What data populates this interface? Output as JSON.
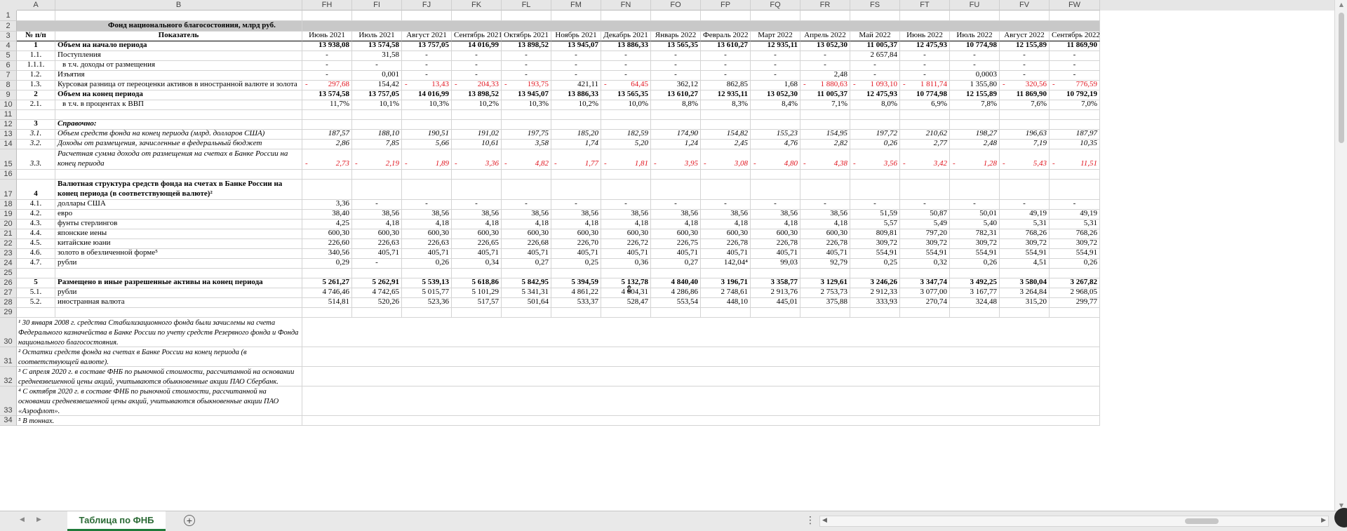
{
  "columns": [
    "A",
    "B",
    "FH",
    "FI",
    "FJ",
    "FK",
    "FL",
    "FM",
    "FN",
    "FO",
    "FP",
    "FQ",
    "FR",
    "FS",
    "FT",
    "FU",
    "FV",
    "FW"
  ],
  "title": "Фонд национального благосостояния, млрд руб.",
  "header": {
    "num": "№ п/п",
    "indicator": "Показатель",
    "months": [
      "Июнь 2021",
      "Июль 2021",
      "Август 2021",
      "Сентябрь 2021",
      "Октябрь 2021",
      "Ноябрь 2021",
      "Декабрь 2021",
      "Январь 2022",
      "Февраль 2022",
      "Март 2022",
      "Апрель 2022",
      "Май 2022",
      "Июнь 2022",
      "Июль 2022",
      "Август 2022",
      "Сентябрь 2022"
    ]
  },
  "rows": [
    {
      "r": "4",
      "num": "1",
      "label": "Объем на начало периода",
      "style": "b",
      "values": [
        "13 938,08",
        "13 574,58",
        "13 757,05",
        "14 016,99",
        "13 898,52",
        "13 945,07",
        "13 886,33",
        "13 565,35",
        "13 610,27",
        "12 935,11",
        "13 052,30",
        "11 005,37",
        "12 475,93",
        "10 774,98",
        "12 155,89",
        "11 869,90"
      ]
    },
    {
      "r": "5",
      "num": "1.1.",
      "label": "Поступления",
      "style": "",
      "values": [
        "-",
        "31,58",
        "-",
        "-",
        "-",
        "-",
        "-",
        "-",
        "-",
        "-",
        "-",
        "2 657,84",
        "-",
        "-",
        "-",
        "-"
      ]
    },
    {
      "r": "6",
      "num": "1.1.1.",
      "label": "в т.ч. доходы от размещения",
      "style": "indent",
      "values": [
        "-",
        "-",
        "-",
        "-",
        "-",
        "-",
        "-",
        "-",
        "-",
        "-",
        "-",
        "-",
        "-",
        "-",
        "-",
        "-"
      ]
    },
    {
      "r": "7",
      "num": "1.2.",
      "label": "Изъятия",
      "style": "",
      "values": [
        "-",
        "0,001",
        "-",
        "-",
        "-",
        "-",
        "-",
        "-",
        "-",
        "-",
        "2,48",
        "-",
        "-",
        "0,0003",
        "-",
        "-"
      ]
    },
    {
      "r": "8",
      "num": "1.3.",
      "label": "Курсовая разница от переоценки активов в иностранной валюте и золота",
      "style": "",
      "values": [
        "297,68",
        "154,42",
        "13,43",
        "204,33",
        "193,75",
        "421,11",
        "64,45",
        "362,12",
        "862,85",
        "1,68",
        "1 880,63",
        "1 093,10",
        "1 811,74",
        "1 355,80",
        "320,56",
        "776,59"
      ],
      "neg": [
        0,
        2,
        3,
        4,
        6,
        10,
        11,
        12,
        14,
        15
      ]
    },
    {
      "r": "9",
      "num": "2",
      "label": "Объем на конец периода",
      "style": "b",
      "values": [
        "13 574,58",
        "13 757,05",
        "14 016,99",
        "13 898,52",
        "13 945,07",
        "13 886,33",
        "13 565,35",
        "13 610,27",
        "12 935,11",
        "13 052,30",
        "11 005,37",
        "12 475,93",
        "10 774,98",
        "12 155,89",
        "11 869,90",
        "10 792,19"
      ]
    },
    {
      "r": "10",
      "num": "2.1.",
      "label": "в т.ч. в процентах к ВВП",
      "style": "indent",
      "values": [
        "11,7%",
        "10,1%",
        "10,3%",
        "10,2%",
        "10,3%",
        "10,2%",
        "10,0%",
        "8,8%",
        "8,3%",
        "8,4%",
        "7,1%",
        "8,0%",
        "6,9%",
        "7,8%",
        "7,6%",
        "7,0%"
      ]
    },
    {
      "r": "11",
      "num": "",
      "label": "",
      "style": "",
      "values": []
    },
    {
      "r": "12",
      "num": "3",
      "label": "Справочно:",
      "style": "bi",
      "values": []
    },
    {
      "r": "13",
      "num": "3.1.",
      "label": "Объем средств фонда на конец периода (млрд. долларов США)",
      "style": "i",
      "values": [
        "187,57",
        "188,10",
        "190,51",
        "191,02",
        "197,75",
        "185,20",
        "182,59",
        "174,90",
        "154,82",
        "155,23",
        "154,95",
        "197,72",
        "210,62",
        "198,27",
        "196,63",
        "187,97"
      ]
    },
    {
      "r": "14",
      "num": "3.2.",
      "label": "Доходы от размещения, зачисленные в федеральный бюджет",
      "style": "i",
      "values": [
        "2,86",
        "7,85",
        "5,66",
        "10,61",
        "3,58",
        "1,74",
        "5,20",
        "1,24",
        "2,45",
        "4,76",
        "2,82",
        "0,26",
        "2,77",
        "2,48",
        "7,19",
        "10,35"
      ]
    },
    {
      "r": "15",
      "num": "3.3.",
      "label": "Расчетная сумма дохода от размещения на счетах в Банке России на конец периода",
      "style": "i",
      "values": [
        "2,73",
        "2,19",
        "1,89",
        "3,36",
        "4,82",
        "1,77",
        "1,81",
        "3,95",
        "3,08",
        "4,80",
        "4,38",
        "3,56",
        "3,42",
        "1,28",
        "5,43",
        "11,51"
      ],
      "neg": [
        0,
        1,
        2,
        3,
        4,
        5,
        6,
        7,
        8,
        9,
        10,
        11,
        12,
        13,
        14,
        15
      ]
    },
    {
      "r": "16",
      "num": "",
      "label": "",
      "style": "",
      "values": []
    },
    {
      "r": "17",
      "num": "4",
      "label": "Валютная структура средств фонда на счетах в Банке России на конец периода (в соответствующей валюте)²",
      "style": "b",
      "values": []
    },
    {
      "r": "18",
      "num": "4.1.",
      "label": "доллары США",
      "style": "",
      "values": [
        "3,36",
        "-",
        "-",
        "-",
        "-",
        "-",
        "-",
        "-",
        "-",
        "-",
        "-",
        "-",
        "-",
        "-",
        "-",
        "-"
      ]
    },
    {
      "r": "19",
      "num": "4.2.",
      "label": "евро",
      "style": "",
      "values": [
        "38,40",
        "38,56",
        "38,56",
        "38,56",
        "38,56",
        "38,56",
        "38,56",
        "38,56",
        "38,56",
        "38,56",
        "38,56",
        "51,59",
        "50,87",
        "50,01",
        "49,19",
        "49,19"
      ]
    },
    {
      "r": "20",
      "num": "4.3.",
      "label": "фунты стерлингов",
      "style": "",
      "values": [
        "4,25",
        "4,18",
        "4,18",
        "4,18",
        "4,18",
        "4,18",
        "4,18",
        "4,18",
        "4,18",
        "4,18",
        "4,18",
        "5,57",
        "5,49",
        "5,40",
        "5,31",
        "5,31"
      ]
    },
    {
      "r": "21",
      "num": "4.4.",
      "label": "японские иены",
      "style": "",
      "values": [
        "600,30",
        "600,30",
        "600,30",
        "600,30",
        "600,30",
        "600,30",
        "600,30",
        "600,30",
        "600,30",
        "600,30",
        "600,30",
        "809,81",
        "797,20",
        "782,31",
        "768,26",
        "768,26"
      ]
    },
    {
      "r": "22",
      "num": "4.5.",
      "label": "китайские юани",
      "style": "",
      "values": [
        "226,60",
        "226,63",
        "226,63",
        "226,65",
        "226,68",
        "226,70",
        "226,72",
        "226,75",
        "226,78",
        "226,78",
        "226,78",
        "309,72",
        "309,72",
        "309,72",
        "309,72",
        "309,72"
      ]
    },
    {
      "r": "23",
      "num": "4.6.",
      "label": "золото в обезличенной форме⁵",
      "style": "",
      "values": [
        "340,56",
        "405,71",
        "405,71",
        "405,71",
        "405,71",
        "405,71",
        "405,71",
        "405,71",
        "405,71",
        "405,71",
        "405,71",
        "554,91",
        "554,91",
        "554,91",
        "554,91",
        "554,91"
      ]
    },
    {
      "r": "24",
      "num": "4.7.",
      "label": "рубли",
      "style": "",
      "values": [
        "0,29",
        "-",
        "0,26",
        "0,34",
        "0,27",
        "0,25",
        "0,36",
        "0,27",
        "142,04⁴",
        "99,03",
        "92,79",
        "0,25",
        "0,32",
        "0,26",
        "4,51",
        "0,26"
      ]
    },
    {
      "r": "25",
      "num": "",
      "label": "",
      "style": "",
      "values": []
    },
    {
      "r": "26",
      "num": "5",
      "label": "Размещено в иные разрешенные активы на конец периода",
      "style": "b",
      "values": [
        "5 261,27",
        "5 262,91",
        "5 539,13",
        "5 618,86",
        "5 842,95",
        "5 394,59",
        "5 132,78",
        "4 840,40",
        "3 196,71",
        "3 358,77",
        "3 129,61",
        "3 246,26",
        "3 347,74",
        "3 492,25",
        "3 580,04",
        "3 267,82"
      ]
    },
    {
      "r": "27",
      "num": "5.1.",
      "label": "рубли",
      "style": "",
      "values": [
        "4 746,46",
        "4 742,65",
        "5 015,77",
        "5 101,29",
        "5 341,31",
        "4 861,22",
        "4 604,31",
        "4 286,86",
        "2 748,61",
        "2 913,76",
        "2 753,73",
        "2 912,33",
        "3 077,00",
        "3 167,77",
        "3 264,84",
        "2 968,05"
      ]
    },
    {
      "r": "28",
      "num": "5.2.",
      "label": "иностранная валюта",
      "style": "",
      "values": [
        "514,81",
        "520,26",
        "523,36",
        "517,57",
        "501,64",
        "533,37",
        "528,47",
        "553,54",
        "448,10",
        "445,01",
        "375,88",
        "333,93",
        "270,74",
        "324,48",
        "315,20",
        "299,77"
      ]
    }
  ],
  "footnotes": [
    {
      "r": "30",
      "text": "¹ 30 января 2008 г. средства Стабилизационного фонда были зачислены на счета Федерального казначейства в Банке России по учету средств Резервного фонда и Фонда национального благосостояния."
    },
    {
      "r": "31",
      "text": "² Остатки средств фонда на счетах в Банке России на конец периода (в соответствующей валюте)."
    },
    {
      "r": "32",
      "text": "³ С апреля 2020 г. в составе ФНБ по рыночной стоимости, рассчитанной на основании средневзвешенной цены акций, учитываются обыкновенные акции ПАО Сбербанк."
    },
    {
      "r": "33",
      "text": "⁴ С октября 2020 г. в составе ФНБ по рыночной стоимости, рассчитанной на основании средневзвешенной цены акций, учитываются обыкновенные акции ПАО «Аэрофлот»."
    },
    {
      "r": "34",
      "text": "⁵ В тоннах."
    }
  ],
  "tabs": {
    "sheet": "Таблица по ФНБ",
    "add": "+",
    "prev": "◀",
    "next": "▶",
    "more": "⋮"
  },
  "scroll": {
    "left": "◀",
    "right": "▶",
    "up": "▲",
    "down": "▼"
  },
  "cursor": "⇕"
}
